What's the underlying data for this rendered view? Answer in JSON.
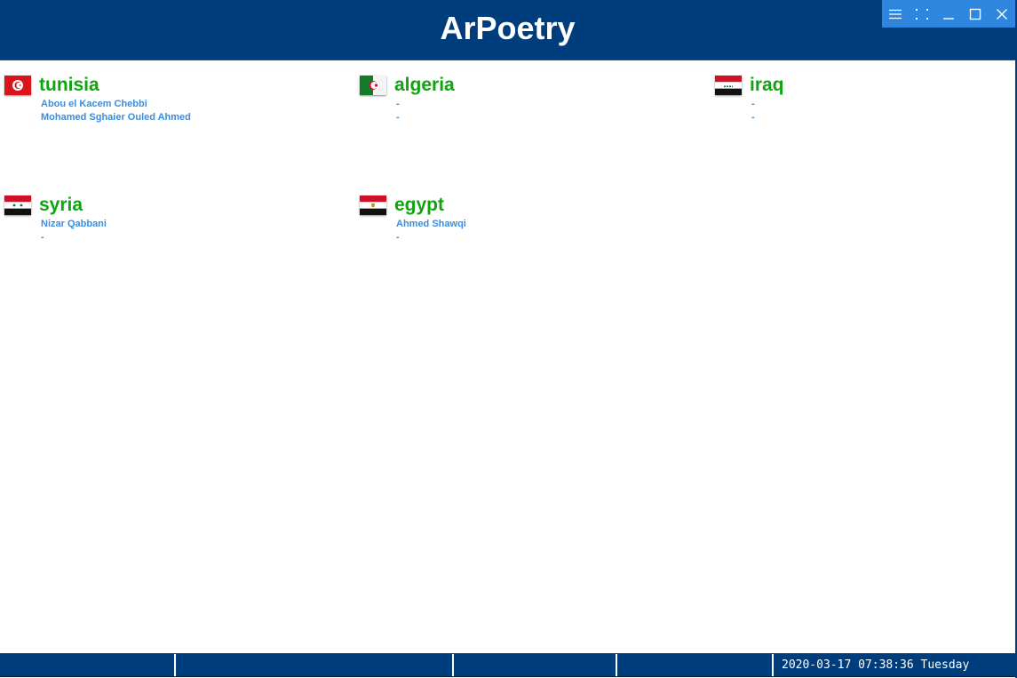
{
  "app": {
    "title": "ArPoetry"
  },
  "window_controls": [
    {
      "name": "menu-icon"
    },
    {
      "name": "fullscreen-icon"
    },
    {
      "name": "minimize-icon"
    },
    {
      "name": "maximize-icon"
    },
    {
      "name": "close-icon"
    }
  ],
  "countries": [
    {
      "name": "tunisia",
      "flag": "tunisia-flag-icon",
      "poets": [
        "Abou el Kacem Chebbi",
        "Mohamed Sghaier Ouled Ahmed"
      ]
    },
    {
      "name": "algeria",
      "flag": "algeria-flag-icon",
      "poets": [
        "-",
        "-"
      ]
    },
    {
      "name": "iraq",
      "flag": "iraq-flag-icon",
      "poets": [
        "-",
        "-"
      ]
    },
    {
      "name": "syria",
      "flag": "syria-flag-icon",
      "poets": [
        "Nizar Qabbani",
        "-"
      ]
    },
    {
      "name": "egypt",
      "flag": "egypt-flag-icon",
      "poets": [
        "Ahmed Shawqi",
        "-"
      ]
    }
  ],
  "colors": {
    "header_bg": "#003d7c",
    "controls_bg": "#2e86de",
    "country_name": "#0ea50e",
    "poet_link": "#3a8de0"
  },
  "statusbar": {
    "clock": "2020-03-17 07:38:36 Tuesday"
  }
}
